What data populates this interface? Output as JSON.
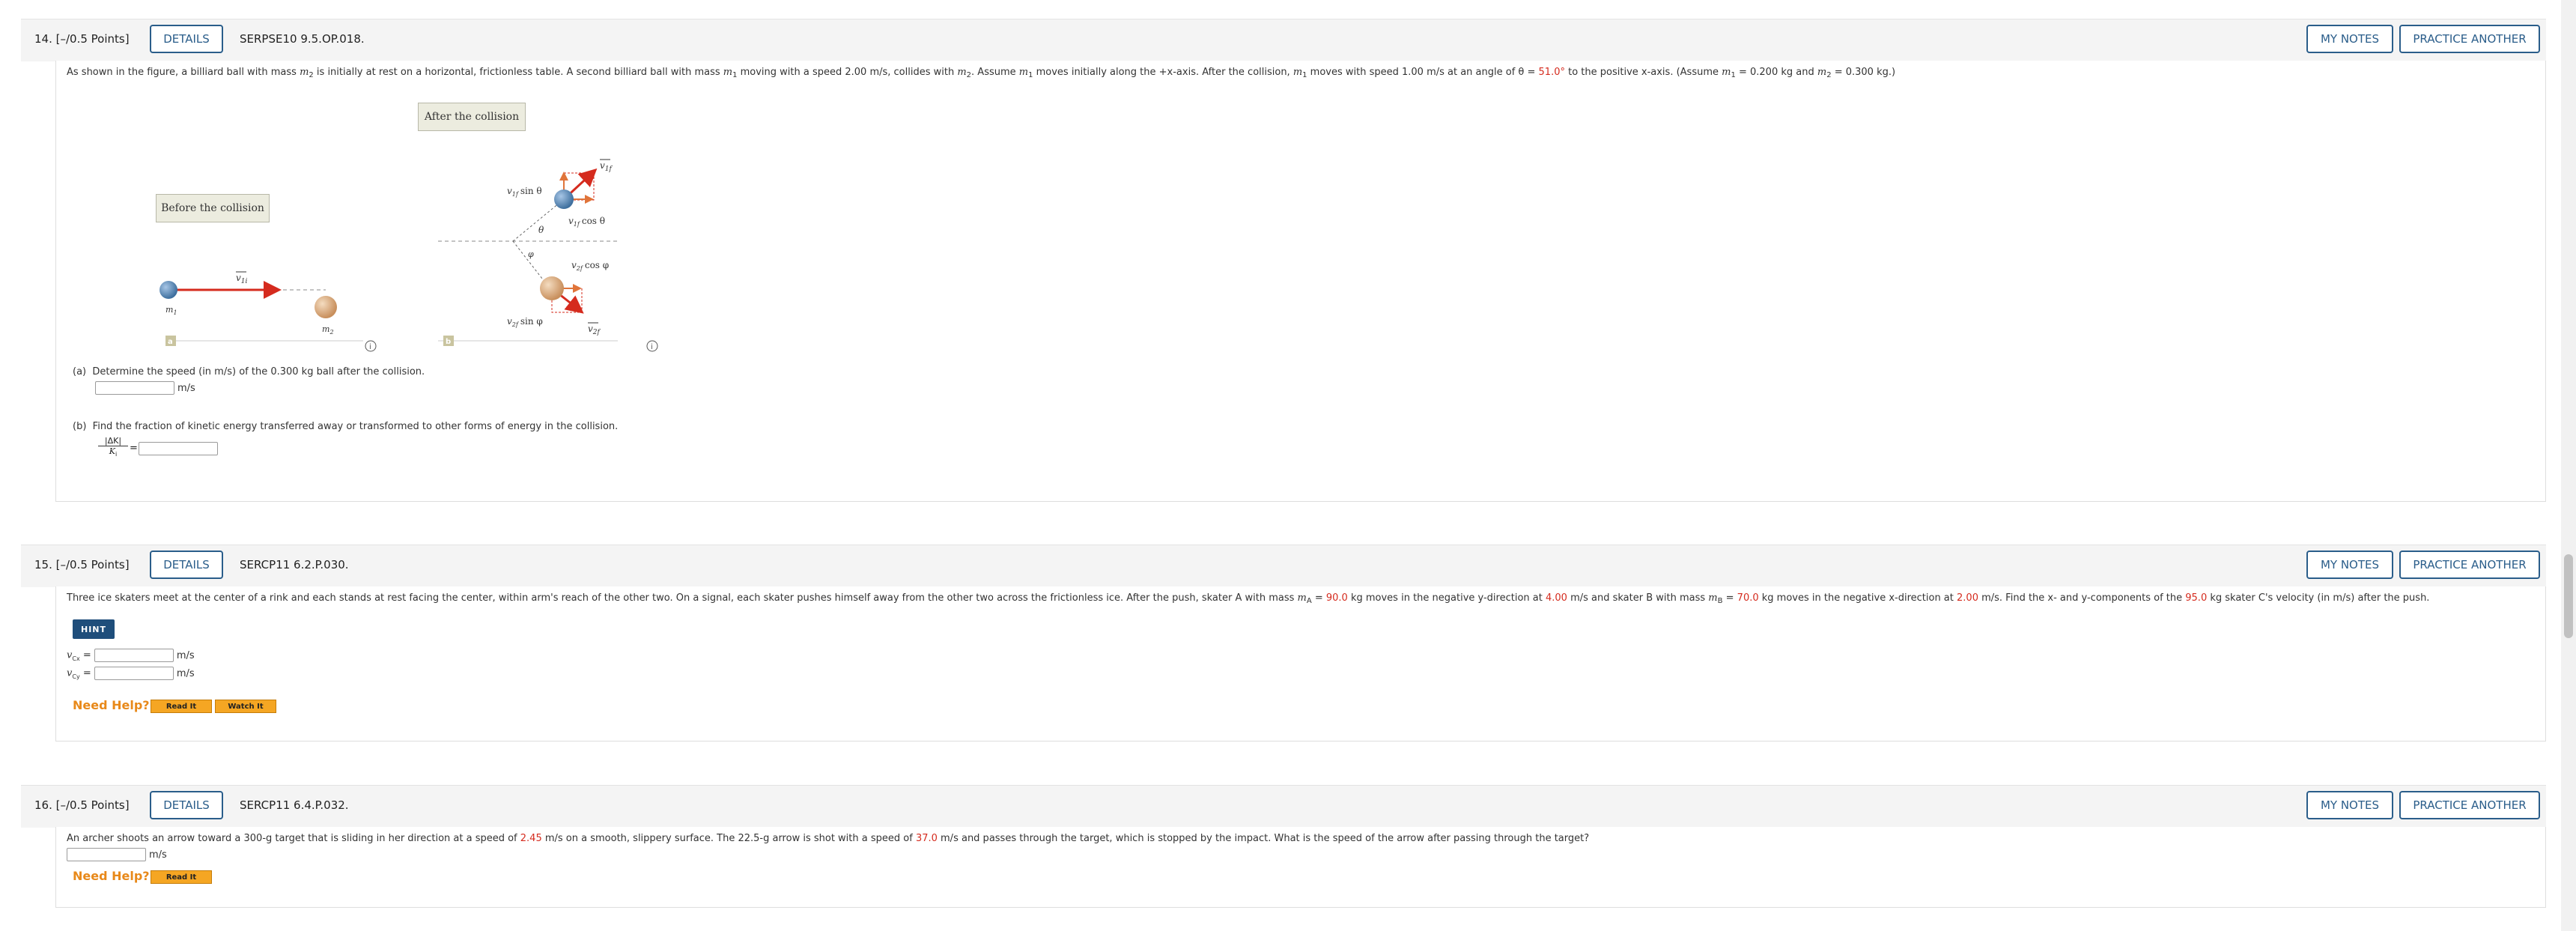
{
  "q14": {
    "number": "14.  [–/0.5 Points]",
    "details": "DETAILS",
    "code": "SERPSE10 9.5.OP.018.",
    "my_notes": "MY NOTES",
    "practice": "PRACTICE ANOTHER",
    "problem_a": "As shown in the figure, a billiard ball with mass ",
    "problem_b": " is initially at rest on a horizontal, frictionless table. A second billiard ball with mass ",
    "problem_c": " moving with a speed 2.00 m/s, collides with ",
    "problem_d": ". Assume ",
    "problem_e": " moves initially along the +x-axis. After the collision, ",
    "problem_f": " moves with speed 1.00 m/s at an angle of θ = ",
    "angle": "51.0°",
    "problem_g": " to the positive x-axis. (Assume ",
    "problem_h": " = 0.200 kg and ",
    "problem_i": " = 0.300 kg.)",
    "m1": "m",
    "m2": "m",
    "sub1": "1",
    "sub2": "2",
    "fig": {
      "before_label": "Before the collision",
      "after_label": "After the collision",
      "v1i": "v",
      "v1i_sub": "1i",
      "m1_label": "m",
      "m2_label": "m",
      "sub_1": "1",
      "sub_2": "2",
      "panel_a": "a",
      "panel_b": "b",
      "v1f": "v",
      "v1f_sub": "1f",
      "v2f": "v",
      "v2f_sub": "2f",
      "v1f_sin": "sin θ",
      "v1f_cos": "cos θ",
      "v2f_cos": "cos φ",
      "v2f_sin": "sin φ",
      "theta": "θ",
      "phi": "φ",
      "info": "i"
    },
    "part_a_label": "(a)",
    "part_a": "Determine the speed (in m/s) of the 0.300 kg ball after the collision.",
    "part_a_unit": "m/s",
    "part_b_label": "(b)",
    "part_b": "Find the fraction of kinetic energy transferred away or transformed to other forms of energy in the collision.",
    "frac_num": "|ΔK|",
    "frac_den": "K",
    "frac_den_sub": "i",
    "equals": "="
  },
  "q15": {
    "number": "15.  [–/0.5 Points]",
    "details": "DETAILS",
    "code": "SERCP11 6.2.P.030.",
    "my_notes": "MY NOTES",
    "practice": "PRACTICE ANOTHER",
    "problem_a": "Three ice skaters meet at the center of a rink and each stands at rest facing the center, within arm's reach of the other two. On a signal, each skater pushes himself away from the other two across the frictionless ice. After the push, skater A with mass ",
    "mA_sym": "m",
    "mA_sub": "A",
    "problem_b": " = ",
    "mA": "90.0",
    "problem_c": " kg moves in the negative y-direction at ",
    "vA": "4.00",
    "problem_d": " m/s and skater B with mass ",
    "mB_sym": "m",
    "mB_sub": "B",
    "problem_e": " = ",
    "mB": "70.0",
    "problem_f": " kg moves in the negative x-direction at ",
    "vB": "2.00",
    "problem_g": " m/s. Find the x- and y-components of the ",
    "mC": "95.0",
    "problem_h": " kg skater C's velocity (in m/s) after the push.",
    "hint": "HINT",
    "vcx_label": "v",
    "vcx_sub": "Cx",
    "vcy_label": "v",
    "vcy_sub": "Cy",
    "equals": "=",
    "unit": "m/s",
    "need_help": "Need Help?",
    "read_it": "Read It",
    "watch_it": "Watch It"
  },
  "q16": {
    "number": "16.  [–/0.5 Points]",
    "details": "DETAILS",
    "code": "SERCP11 6.4.P.032.",
    "my_notes": "MY NOTES",
    "practice": "PRACTICE ANOTHER",
    "problem_a": "An archer shoots an arrow toward a 300-g target that is sliding in her direction at a speed of ",
    "v_target": "2.45",
    "problem_b": " m/s on a smooth, slippery surface. The 22.5-g arrow is shot with a speed of ",
    "v_arrow": "37.0",
    "problem_c": " m/s and passes through the target, which is stopped by the impact. What is the speed of the arrow after passing through the target?",
    "unit": "m/s",
    "need_help": "Need Help?",
    "read_it": "Read It"
  },
  "colors": {
    "accent": "#2a5d8a",
    "highlight": "#d52b1e",
    "help": "#e8891a",
    "hint_bg": "#1f4e7b"
  }
}
